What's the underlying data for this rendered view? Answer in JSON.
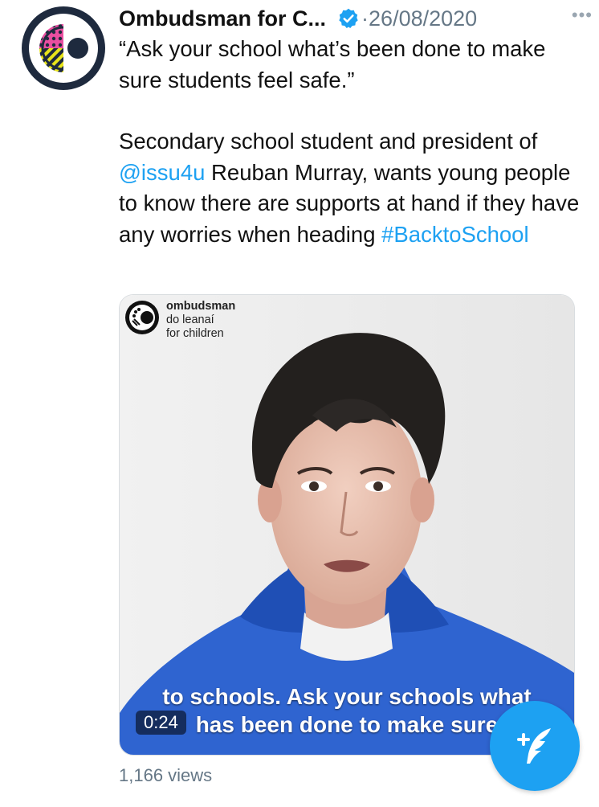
{
  "tweet": {
    "author_name": "Ombudsman for C...",
    "separator": "·",
    "date": "26/08/2020",
    "more_label": "•••",
    "text_quote": "“Ask your school what’s been done to make sure students feel safe.”",
    "text_part1": "Secondary school student and president of ",
    "mention": "@issu4u",
    "text_part2": " Reuban Murray, wants young people to know there are supports at hand if they have any worries when heading ",
    "hashtag": "#BacktoSchool",
    "views": "1,166 views"
  },
  "media": {
    "brand_line1": "ombudsman",
    "brand_line2": "do leanaí",
    "brand_line3": "for children",
    "subtitle_line1": "to schools. Ask your schools what",
    "subtitle_line2": "has been done to make sure",
    "timer": "0:24"
  },
  "colors": {
    "accent": "#1da1f2",
    "avatar_ring": "#1e2a3e",
    "hoodie": "#2f64d0"
  },
  "icons": {
    "verified": "verified-badge-icon",
    "compose": "compose-tweet-icon",
    "more": "more-options-icon"
  }
}
